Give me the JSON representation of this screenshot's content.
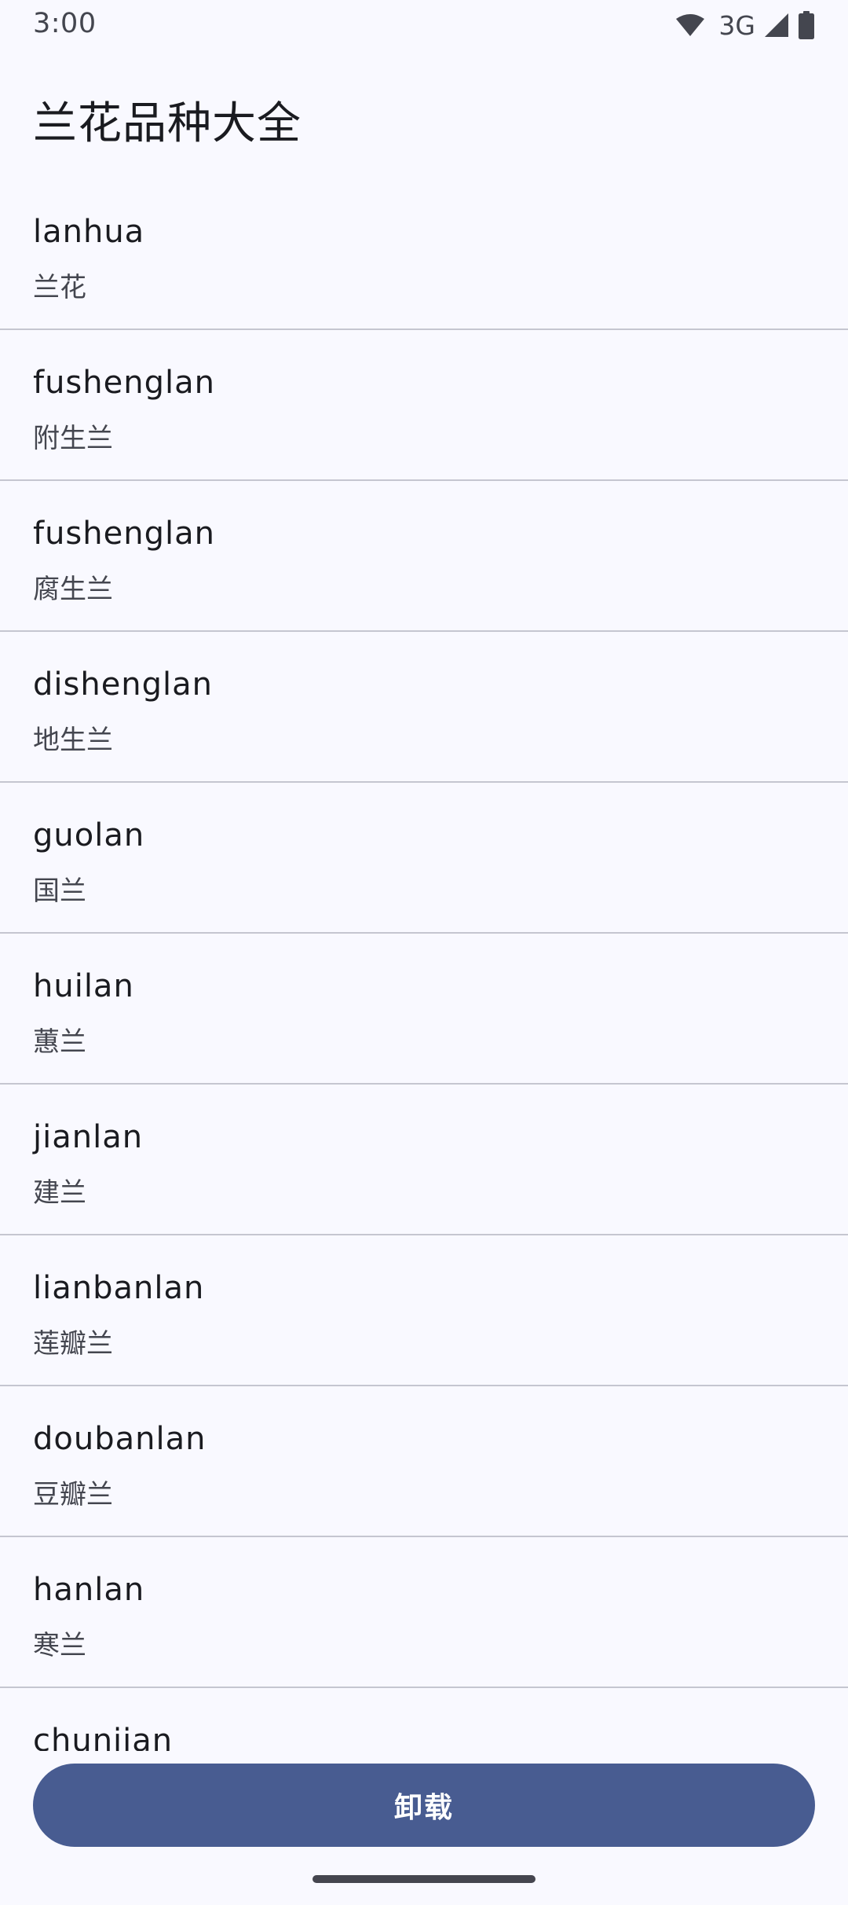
{
  "status_bar": {
    "time": "3:00",
    "network": "3G",
    "icons": [
      "wifi-icon",
      "signal-icon",
      "battery-icon"
    ]
  },
  "app": {
    "title": "兰花品种大全"
  },
  "list": {
    "items": [
      {
        "title": "lanhua",
        "subtitle": "兰花"
      },
      {
        "title": "fushenglan",
        "subtitle": "附生兰"
      },
      {
        "title": "fushenglan",
        "subtitle": "腐生兰"
      },
      {
        "title": "dishenglan",
        "subtitle": "地生兰"
      },
      {
        "title": "guolan",
        "subtitle": "国兰"
      },
      {
        "title": "huilan",
        "subtitle": "蕙兰"
      },
      {
        "title": "jianlan",
        "subtitle": "建兰"
      },
      {
        "title": "lianbanlan",
        "subtitle": "莲瓣兰"
      },
      {
        "title": "doubanlan",
        "subtitle": "豆瓣兰"
      },
      {
        "title": "hanlan",
        "subtitle": "寒兰"
      },
      {
        "title": "chunjian",
        "subtitle": ""
      }
    ]
  },
  "actions": {
    "uninstall_label": "卸载"
  },
  "colors": {
    "background": "#f9f9ff",
    "primary_button": "#485c91",
    "divider": "#c5c6d0",
    "text_primary": "#1a1b20",
    "text_secondary": "#44464f"
  }
}
